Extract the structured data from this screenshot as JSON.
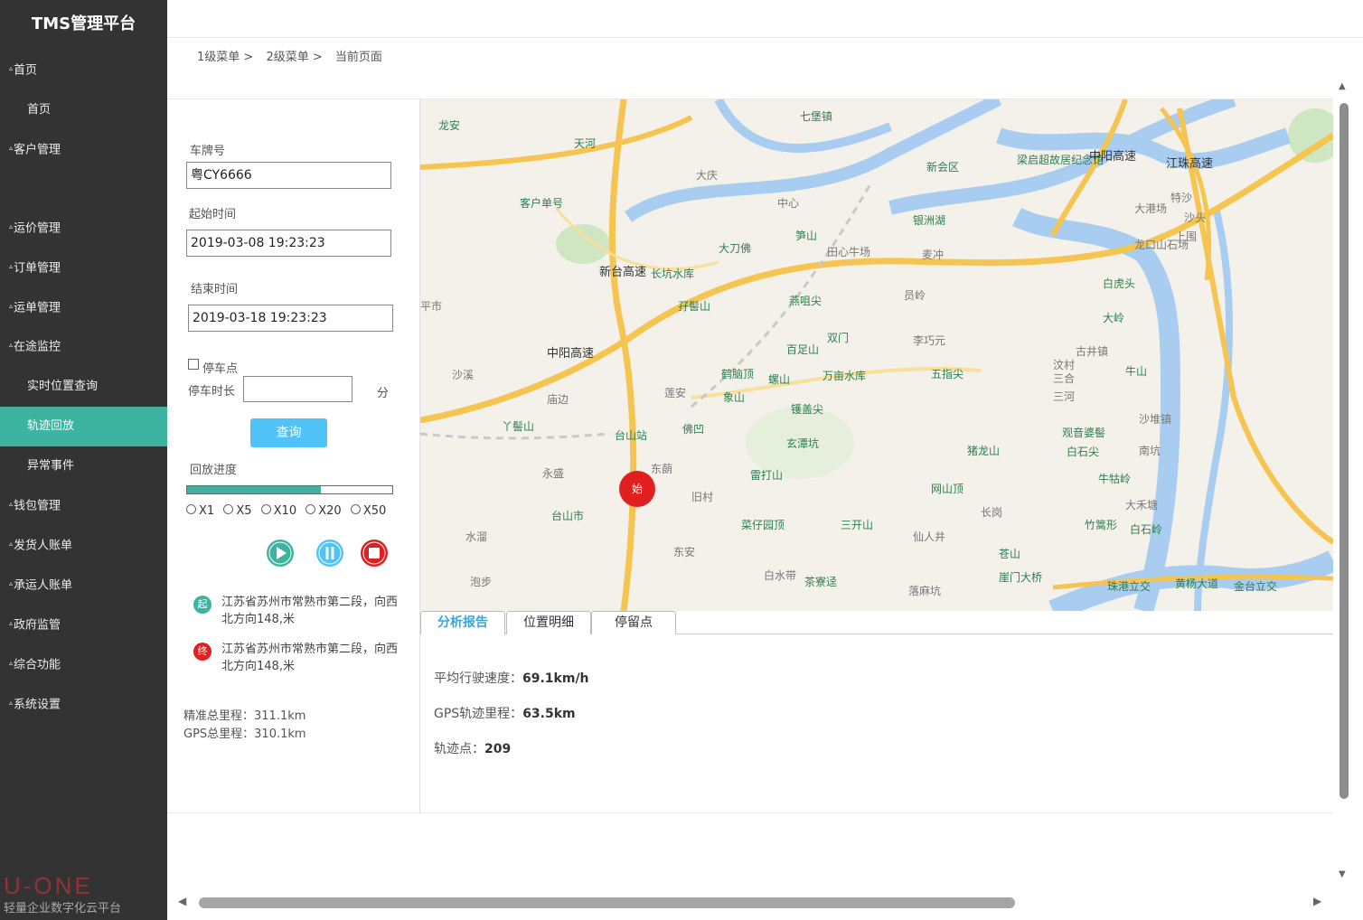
{
  "app": {
    "title": "TMS管理平台"
  },
  "sidebar": {
    "items": [
      {
        "label": "首页",
        "type": "group"
      },
      {
        "label": "首页",
        "type": "sub"
      },
      {
        "label": "客户管理",
        "type": "group"
      },
      {
        "label": "运价管理",
        "type": "group"
      },
      {
        "label": "订单管理",
        "type": "group"
      },
      {
        "label": "运单管理",
        "type": "group"
      },
      {
        "label": "在途监控",
        "type": "group"
      },
      {
        "label": "实时位置查询",
        "type": "sub"
      },
      {
        "label": "轨迹回放",
        "type": "sub",
        "active": true
      },
      {
        "label": "异常事件",
        "type": "sub"
      },
      {
        "label": "钱包管理",
        "type": "group"
      },
      {
        "label": "发货人账单",
        "type": "group"
      },
      {
        "label": "承运人账单",
        "type": "group"
      },
      {
        "label": "政府监管",
        "type": "group"
      },
      {
        "label": "综合功能",
        "type": "group"
      },
      {
        "label": "系统设置",
        "type": "group"
      }
    ],
    "watermark_logo": "U-ONE",
    "watermark_slogan": "轻量企业数字化云平台"
  },
  "breadcrumb": [
    "1级菜单 >",
    "2级菜单 >",
    "当前页面"
  ],
  "form": {
    "plate_label": "车牌号",
    "plate_value": "粤CY6666",
    "start_label": "起始时间",
    "start_value": "2019-03-08 19:23:23",
    "end_label": "结束时间",
    "end_value": "2019-03-18 19:23:23",
    "stop_checkbox_label": "停车点",
    "stop_duration_label": "停车时长",
    "stop_duration_value": "",
    "stop_duration_unit": "分",
    "query_button": "查询"
  },
  "playback": {
    "progress_label": "回放进度",
    "progress": 0.65,
    "speeds": [
      "X1",
      "X5",
      "X10",
      "X20",
      "X50"
    ]
  },
  "locations": {
    "start_badge": "起",
    "start_text": "江苏省苏州市常熟市第二段，向西北方向148,米",
    "end_badge": "终",
    "end_text": "江苏省苏州市常熟市第二段，向西北方向148,米"
  },
  "totals": {
    "precise": "精准总里程：311.1km",
    "gps": "GPS总里程：310.1km"
  },
  "map": {
    "start_marker": "始",
    "labels": [
      "龙安",
      "天河",
      "七堡镇",
      "新会区",
      "梁启超故居纪念馆",
      "中阳高速",
      "客户单号",
      "大刀佛",
      "笋山",
      "银洲湖",
      "长坑水库",
      "孖髻山",
      "燕咀尖",
      "双门",
      "百足山",
      "万亩水库",
      "鹤脑顶",
      "螺山",
      "象山",
      "镬盖尖",
      "佛凹",
      "台山站",
      "丫髻山",
      "玄潭坑",
      "雷打山",
      "菜仔园顶",
      "三开山",
      "网山顶",
      "猪龙山",
      "五指尖",
      "观音婆髻",
      "白石尖",
      "牛牯岭",
      "竹篙形",
      "白石岭",
      "牛山",
      "白虎头",
      "大岭",
      "江珠高速",
      "台山市",
      "黄杨大道",
      "珠港立交",
      "金台立交",
      "茶寮迳",
      "苍山",
      "崖门大桥",
      "新台高速",
      "中阳高速",
      "平市",
      "大庆",
      "中心",
      "田心牛场",
      "麦冲",
      "员岭",
      "李巧元",
      "古井镇",
      "三河",
      "南坑",
      "沙堆镇",
      "大禾塘",
      "长岗",
      "仙人井",
      "落麻坑",
      "白水带",
      "东安",
      "旧村",
      "东蓢",
      "莲安",
      "庙边",
      "水溜",
      "泡步",
      "永盛",
      "沙溪",
      "三合",
      "汶村",
      "龙口山石场",
      "大港场",
      "特沙",
      "上围",
      "沙头"
    ]
  },
  "tabs": [
    {
      "label": "分析报告",
      "active": true
    },
    {
      "label": "位置明细",
      "active": false
    },
    {
      "label": "停留点",
      "active": false
    }
  ],
  "stats": {
    "avg_speed_label": "平均行驶速度：",
    "avg_speed_value": "69.1km/h",
    "gps_distance_label": "GPS轨迹里程：",
    "gps_distance_value": "63.5km",
    "points_label": "轨迹点：",
    "points_value": "209"
  },
  "colors": {
    "sidebar_bg": "#333333",
    "accent": "#3db3a0",
    "query_button": "#4fc3f7",
    "tab_active": "#3aa4d8",
    "marker_red": "#e02020"
  }
}
